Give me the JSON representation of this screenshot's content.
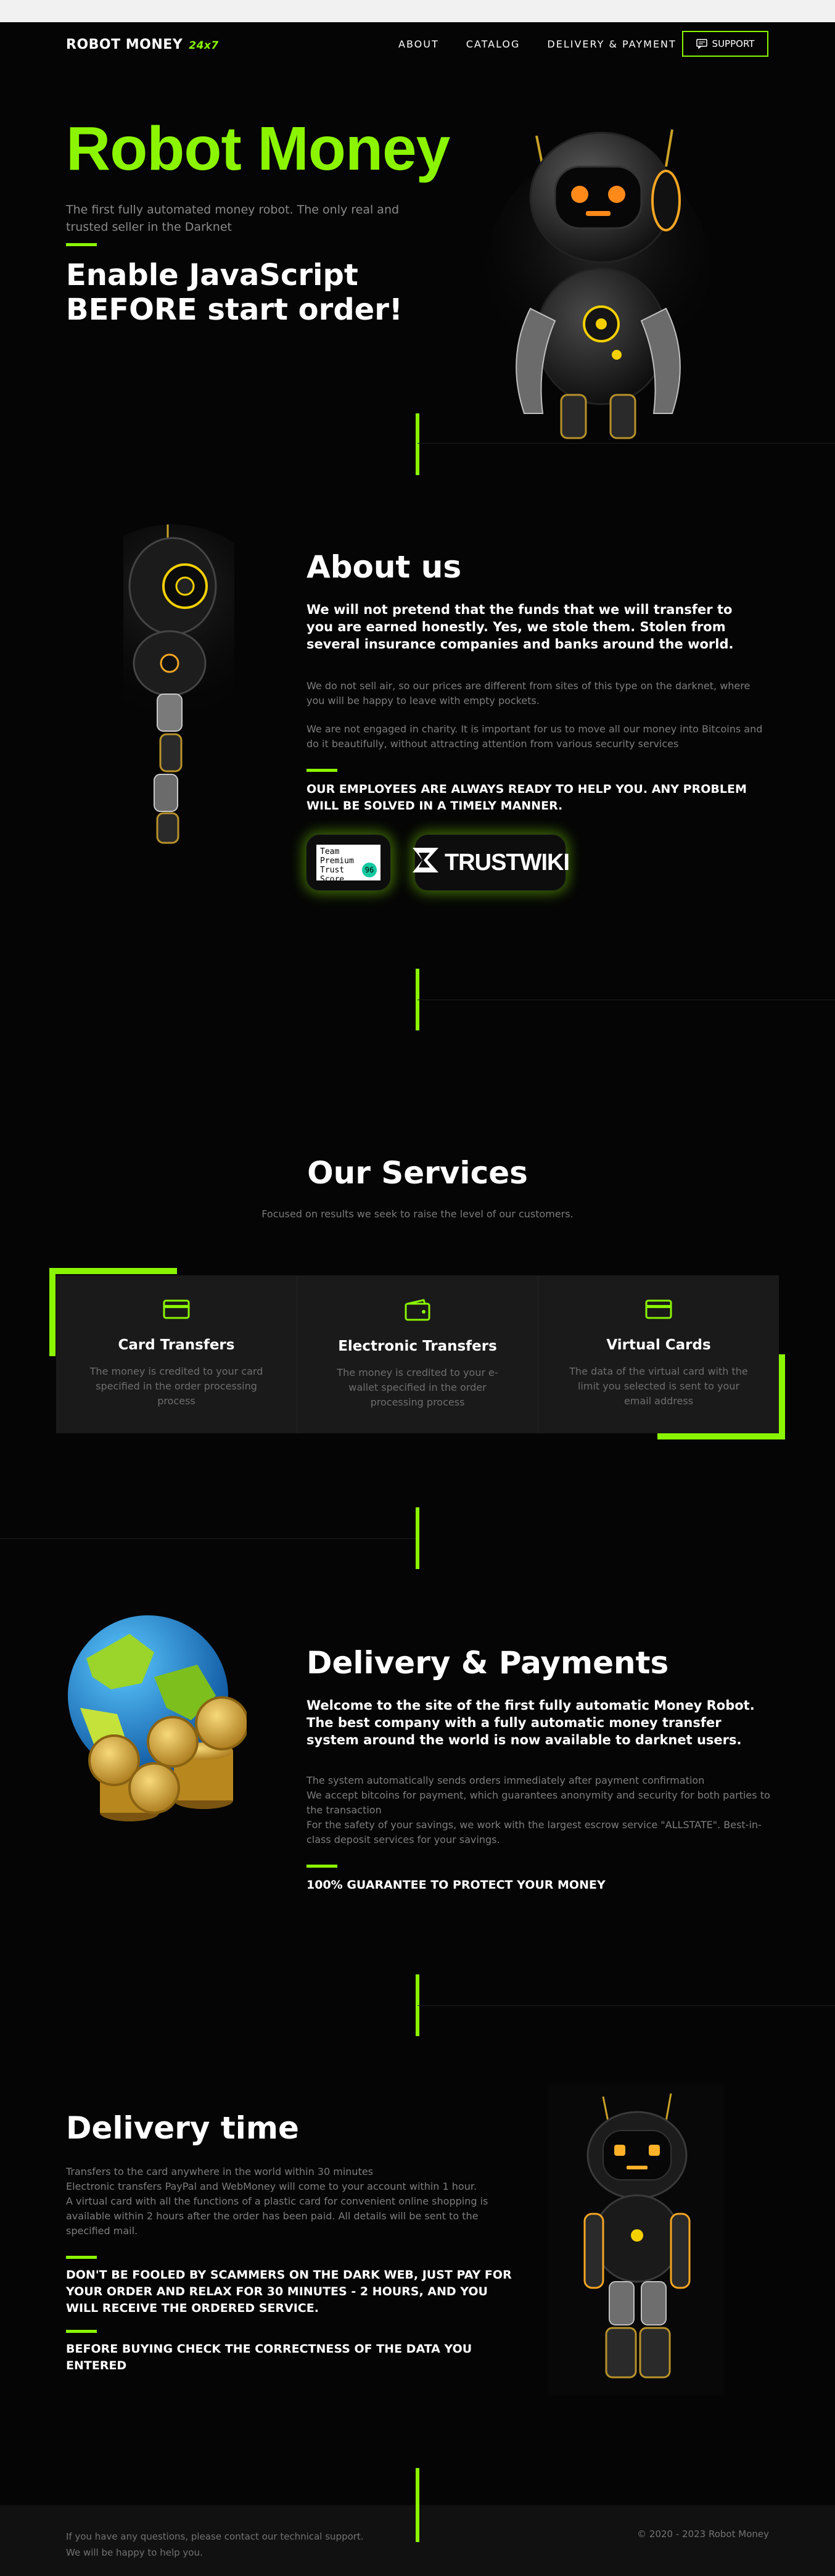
{
  "header": {
    "logo": "ROBOT MONEY",
    "logo_tag": "24x7",
    "nav": [
      "ABOUT",
      "CATALOG",
      "DELIVERY & PAYMENT"
    ],
    "support": "SUPPORT"
  },
  "hero": {
    "title": "Robot Money",
    "subtitle": "The first fully automated money robot. The only real and trusted seller in the Darknet",
    "warning": "Enable JavaScript BEFORE start order!"
  },
  "about": {
    "title": "About us",
    "lead": "We will not pretend that the funds that we will transfer to you are earned honestly. Yes, we stole them. Stolen from several insurance companies and banks around the world.",
    "p1": "We do not sell air, so our prices are different from sites of this type on the darknet, where you will be happy to leave with empty pockets.",
    "p2": "We are not engaged in charity. It is important for us to move all our money into Bitcoins and do it beautifully, without attracting attention from various security services",
    "caps": "OUR EMPLOYEES ARE ALWAYS READY TO HELP YOU. ANY PROBLEM WILL BE SOLVED IN A TIMELY MANNER.",
    "badge1_lines": [
      "Team Premium",
      "Trust",
      "Score"
    ],
    "badge1_score": "96",
    "badge2": "TRUSTWIKI"
  },
  "services": {
    "title": "Our Services",
    "subtitle": "Focused on results we seek to raise the level of our customers.",
    "cards": [
      {
        "icon": "credit-card-icon",
        "title": "Card Transfers",
        "text": "The money is credited to your card specified in the order processing process"
      },
      {
        "icon": "wallet-icon",
        "title": "Electronic Transfers",
        "text": "The money is credited to your e-wallet specified in the order processing process"
      },
      {
        "icon": "credit-card-icon",
        "title": "Virtual Cards",
        "text": "The data of the virtual card with the limit you selected is sent to your email address"
      }
    ]
  },
  "delivery": {
    "title": "Delivery & Payments",
    "lead": "Welcome to the site of the first fully automatic Money Robot. The best company with a fully automatic money transfer system around the world is now available to darknet users.",
    "lines": [
      "The system automatically sends orders immediately after payment confirmation",
      "We accept bitcoins for payment, which guarantees anonymity and security for both parties to the transaction",
      "For the safety of your savings, we work with the largest escrow service \"ALLSTATE\". Best-in-class deposit services for your savings."
    ],
    "caps": "100% GUARANTEE TO PROTECT YOUR MONEY"
  },
  "delivery_time": {
    "title": "Delivery time",
    "lines": [
      "Transfers to the card anywhere in the world within 30 minutes",
      "Electronic transfers PayPal and WebMoney will come to your account within 1 hour.",
      "A virtual card with all the functions of a plastic card for convenient online shopping is available within 2 hours after the order has been paid. All details will be sent to the specified mail."
    ],
    "caps1": "DON'T BE FOOLED BY SCAMMERS ON THE DARK WEB, JUST PAY FOR YOUR ORDER AND RELAX FOR 30 MINUTES - 2 HOURS, AND YOU WILL RECEIVE THE ORDERED SERVICE.",
    "caps2": "BEFORE BUYING CHECK THE CORRECTNESS OF THE DATA YOU ENTERED"
  },
  "footer": {
    "left1": "If you have any questions, please contact our technical support.",
    "left2": "We will be happy to help you.",
    "right": "© 2020 - 2023 Robot Money"
  },
  "colors": {
    "accent": "#8bf500",
    "background": "#050505",
    "card": "#1a1a1a"
  }
}
